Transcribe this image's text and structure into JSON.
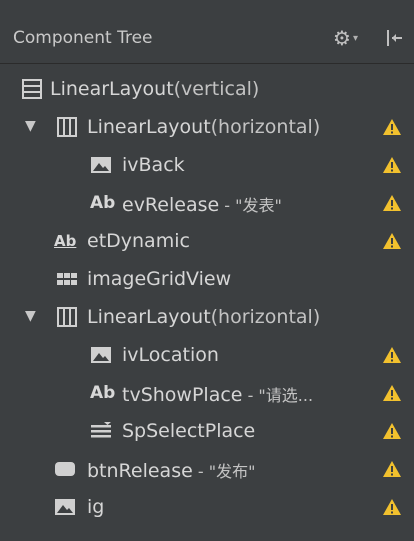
{
  "header": {
    "title": "Component Tree"
  },
  "colors": {
    "warning": "#f2c12e",
    "background": "#3c3f41",
    "icon": "#d0d0d0"
  },
  "tree": [
    {
      "label": "LinearLayout",
      "sub": "(vertical)",
      "extra": "",
      "icon": "vertical-layout-icon",
      "expanded": true,
      "warning": false
    },
    {
      "label": "LinearLayout",
      "sub": "(horizontal)",
      "extra": "",
      "icon": "horizontal-layout-icon",
      "expanded": true,
      "warning": true
    },
    {
      "label": "ivBack",
      "sub": "",
      "extra": "",
      "icon": "image-icon",
      "warning": true
    },
    {
      "label": "evRelease",
      "sub": "",
      "extra": " - \"发表\"",
      "icon": "textview-icon",
      "warning": true
    },
    {
      "label": "etDynamic",
      "sub": "",
      "extra": "",
      "icon": "edittext-icon",
      "warning": true
    },
    {
      "label": "imageGridView",
      "sub": "",
      "extra": "",
      "icon": "grid-icon",
      "warning": false
    },
    {
      "label": "LinearLayout",
      "sub": "(horizontal)",
      "extra": "",
      "icon": "horizontal-layout-icon",
      "expanded": true,
      "warning": false
    },
    {
      "label": "ivLocation",
      "sub": "",
      "extra": "",
      "icon": "image-icon",
      "warning": true
    },
    {
      "label": "tvShowPlace",
      "sub": "",
      "extra": " - \"请选...",
      "icon": "textview-icon",
      "warning": true
    },
    {
      "label": "SpSelectPlace",
      "sub": "",
      "extra": "",
      "icon": "spinner-icon",
      "warning": true
    },
    {
      "label": "btnRelease",
      "sub": "",
      "extra": " - \"发布\"",
      "icon": "button-icon",
      "warning": true
    },
    {
      "label": "ig",
      "sub": "",
      "extra": "",
      "icon": "image-icon",
      "warning": true
    }
  ]
}
